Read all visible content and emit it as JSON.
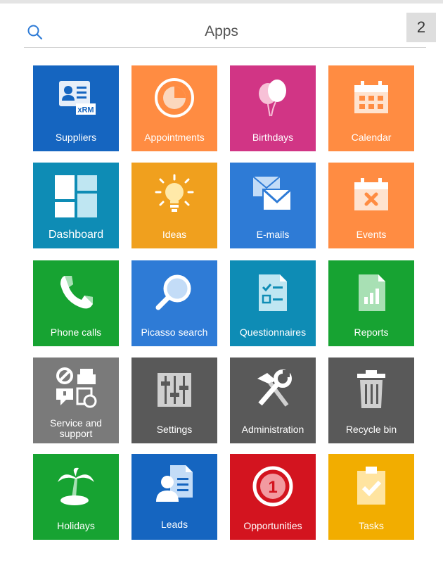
{
  "header": {
    "title": "Apps",
    "page_number": "2"
  },
  "tiles": [
    {
      "label": "Suppliers",
      "color": "#1565c0",
      "icon": "suppliers-icon"
    },
    {
      "label": "Appointments",
      "color": "#ff8c42",
      "icon": "appointments-icon"
    },
    {
      "label": "Birthdays",
      "color": "#d13585",
      "icon": "balloons-icon"
    },
    {
      "label": "Calendar",
      "color": "#ff8c42",
      "icon": "calendar-icon"
    },
    {
      "label": "Dashboard",
      "color": "#0e8cb5",
      "icon": "dashboard-icon"
    },
    {
      "label": "Ideas",
      "color": "#f0a01e",
      "icon": "lightbulb-icon"
    },
    {
      "label": "E-mails",
      "color": "#2e7bd6",
      "icon": "envelopes-icon"
    },
    {
      "label": "Events",
      "color": "#ff8c42",
      "icon": "calendar-x-icon"
    },
    {
      "label": "Phone calls",
      "color": "#17a332",
      "icon": "phone-icon"
    },
    {
      "label": "Picasso search",
      "color": "#2e7bd6",
      "icon": "magnifier-icon"
    },
    {
      "label": "Questionnaires",
      "color": "#0e8cb5",
      "icon": "checklist-icon"
    },
    {
      "label": "Reports",
      "color": "#17a332",
      "icon": "report-icon"
    },
    {
      "label": "Service and support",
      "color": "#7a7a7a",
      "icon": "service-tools-icon"
    },
    {
      "label": "Settings",
      "color": "#595959",
      "icon": "sliders-icon"
    },
    {
      "label": "Administration",
      "color": "#595959",
      "icon": "hammer-wrench-icon"
    },
    {
      "label": "Recycle bin",
      "color": "#595959",
      "icon": "trash-icon"
    },
    {
      "label": "Holidays",
      "color": "#17a332",
      "icon": "palm-tree-icon"
    },
    {
      "label": "Leads",
      "color": "#1565c0",
      "icon": "leads-icon"
    },
    {
      "label": "Opportunities",
      "color": "#d3141f",
      "icon": "opportunity-icon"
    },
    {
      "label": "Tasks",
      "color": "#f2ad00",
      "icon": "clipboard-check-icon"
    }
  ],
  "tile_icon_badges": {
    "suppliers": "xRM",
    "opportunities": "1"
  }
}
